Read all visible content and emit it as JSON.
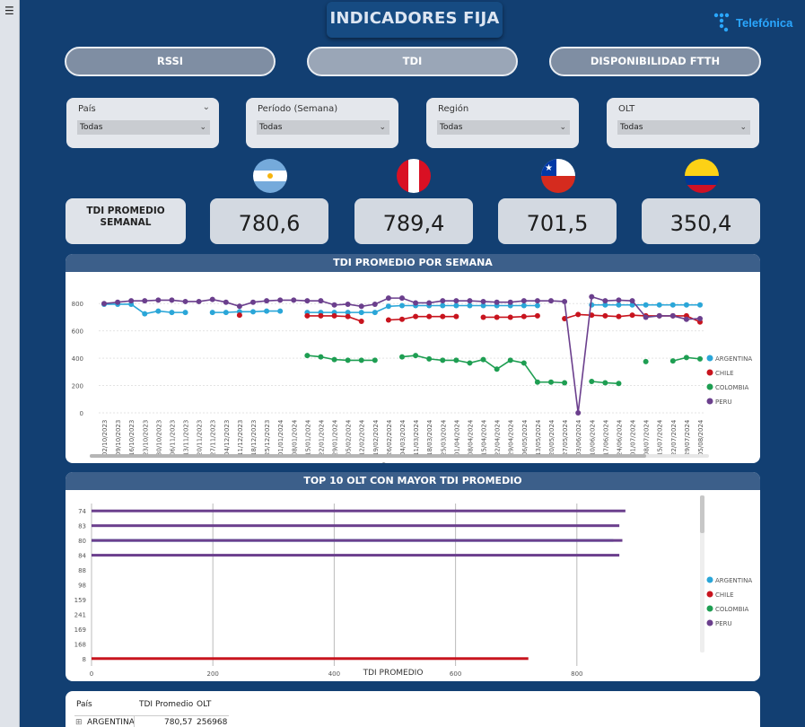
{
  "header": {
    "title": "INDICADORES FIJA",
    "brand": "Telefónica"
  },
  "tabs": [
    {
      "label": "RSSI",
      "active": false
    },
    {
      "label": "TDI",
      "active": true
    },
    {
      "label": "DISPONIBILIDAD FTTH",
      "active": false
    }
  ],
  "filters": [
    {
      "label": "País",
      "value": "Todas"
    },
    {
      "label": "Período (Semana)",
      "value": "Todas"
    },
    {
      "label": "Región",
      "value": "Todas"
    },
    {
      "label": "OLT",
      "value": "Todas"
    }
  ],
  "kpi": {
    "label": "TDI PROMEDIO SEMANAL",
    "values": [
      {
        "country": "Argentina",
        "flag": "argentina-flag-icon",
        "value": "780,6"
      },
      {
        "country": "Peru",
        "flag": "peru-flag-icon",
        "value": "789,4"
      },
      {
        "country": "Chile",
        "flag": "chile-flag-icon",
        "value": "701,5"
      },
      {
        "country": "Colombia",
        "flag": "colombia-flag-icon",
        "value": "350,4"
      }
    ]
  },
  "colors": {
    "ARGENTINA": "#2aa6d8",
    "CHILE": "#c8141e",
    "COLOMBIA": "#1e9e52",
    "PERU": "#6b3f8d"
  },
  "legend": [
    "ARGENTINA",
    "CHILE",
    "COLOMBIA",
    "PERU"
  ],
  "chart_data": [
    {
      "type": "line",
      "title": "TDI PROMEDIO POR SEMANA",
      "xlabel": "Semana",
      "ylabel": "",
      "ylim": [
        0,
        900
      ],
      "yticks": [
        0,
        200,
        400,
        600,
        800
      ],
      "x": [
        "02/10/2023",
        "09/10/2023",
        "16/10/2023",
        "23/10/2023",
        "30/10/2023",
        "06/11/2023",
        "13/11/2023",
        "20/11/2023",
        "27/11/2023",
        "04/12/2023",
        "11/12/2023",
        "18/12/2023",
        "25/12/2023",
        "01/01/2024",
        "08/01/2024",
        "15/01/2024",
        "22/01/2024",
        "29/01/2024",
        "05/02/2024",
        "12/02/2024",
        "19/02/2024",
        "26/02/2024",
        "04/03/2024",
        "11/03/2024",
        "18/03/2024",
        "25/03/2024",
        "01/04/2024",
        "08/04/2024",
        "15/04/2024",
        "22/04/2024",
        "29/04/2024",
        "06/05/2024",
        "13/05/2024",
        "20/05/2024",
        "27/05/2024",
        "03/06/2024",
        "10/06/2024",
        "17/06/2024",
        "24/06/2024",
        "01/07/2024",
        "08/07/2024",
        "15/07/2024",
        "22/07/2024",
        "29/07/2024",
        "05/08/2024"
      ],
      "xticks_shown": [
        "02/10/2023",
        "09/10/2023",
        "16/10/2023",
        "23/10/2023",
        "30/10/2023",
        "06/11/2023",
        "13/11/2023",
        "20/11/2023",
        "27/11/2023",
        "04/12/2023",
        "11/12/2023",
        "18/12/2023",
        "25/12/2023",
        "01/01/2024",
        "08/01/2024",
        "15/01/2024",
        "22/01/2024",
        "29/01/2024",
        "05/02/2024",
        "12/02/2024",
        "19/02/2024",
        "26/02/2024",
        "04/03/2024",
        "11/03/2024",
        "18/03/2024",
        "25/03/2024",
        "01/04/2024",
        "08/04/2024",
        "15/04/2024",
        "22/04/2024",
        "29/04/2024",
        "06/05/2024",
        "13/05/2024",
        "20/05/2024",
        "27/05/2024",
        "03/06/2024",
        "10/06/2024",
        "17/06/2024",
        "24/06/2024",
        "01/07/2024",
        "08/07/2024",
        "15/07/2024",
        "22/07/2024",
        "29/07/2024",
        "05/08/2024"
      ],
      "series": [
        {
          "name": "ARGENTINA",
          "values": [
            795,
            795,
            795,
            725,
            745,
            735,
            735,
            null,
            735,
            735,
            740,
            740,
            745,
            745,
            null,
            735,
            735,
            735,
            735,
            735,
            735,
            780,
            785,
            785,
            785,
            785,
            785,
            785,
            785,
            785,
            785,
            785,
            785,
            null,
            null,
            null,
            790,
            790,
            790,
            790,
            790,
            790,
            790,
            790,
            790
          ]
        },
        {
          "name": "CHILE",
          "values": [
            null,
            null,
            null,
            null,
            null,
            null,
            null,
            null,
            null,
            null,
            715,
            null,
            null,
            null,
            null,
            710,
            710,
            710,
            705,
            670,
            null,
            680,
            685,
            705,
            705,
            705,
            705,
            null,
            700,
            700,
            700,
            705,
            710,
            null,
            690,
            720,
            715,
            710,
            705,
            715,
            710,
            710,
            710,
            710,
            665
          ]
        },
        {
          "name": "COLOMBIA",
          "values": [
            null,
            null,
            null,
            null,
            null,
            null,
            null,
            null,
            null,
            null,
            null,
            null,
            null,
            null,
            null,
            420,
            410,
            390,
            385,
            385,
            385,
            null,
            410,
            420,
            395,
            385,
            385,
            365,
            390,
            320,
            385,
            365,
            225,
            225,
            220,
            null,
            230,
            220,
            215,
            null,
            375,
            null,
            380,
            405,
            395
          ]
        },
        {
          "name": "PERU",
          "values": [
            800,
            810,
            820,
            820,
            825,
            825,
            815,
            815,
            830,
            810,
            780,
            810,
            820,
            825,
            825,
            820,
            820,
            790,
            795,
            780,
            795,
            840,
            840,
            805,
            805,
            820,
            820,
            820,
            815,
            810,
            810,
            820,
            820,
            820,
            815,
            0,
            850,
            820,
            825,
            820,
            700,
            710,
            710,
            685,
            690
          ]
        }
      ]
    },
    {
      "type": "bar",
      "title": "TOP 10 OLT CON MAYOR TDI PROMEDIO",
      "xlabel": "TDI PROMEDIO",
      "ylabel": "",
      "xlim": [
        0,
        1000
      ],
      "xticks": [
        0,
        200,
        400,
        600,
        800
      ],
      "categories": [
        "74",
        "83",
        "80",
        "84",
        "88",
        "98",
        "159",
        "241",
        "169",
        "168",
        "8"
      ],
      "series": [
        {
          "name": "ARGENTINA",
          "values": [
            null,
            null,
            860,
            null,
            null,
            null,
            null,
            null,
            null,
            null,
            null
          ]
        },
        {
          "name": "CHILE",
          "values": [
            null,
            null,
            null,
            null,
            null,
            null,
            null,
            null,
            null,
            null,
            720
          ]
        },
        {
          "name": "COLOMBIA",
          "values": [
            null,
            null,
            null,
            null,
            null,
            null,
            null,
            null,
            null,
            null,
            null
          ]
        },
        {
          "name": "PERU",
          "values": [
            880,
            870,
            875,
            870,
            null,
            null,
            null,
            null,
            null,
            null,
            null
          ]
        }
      ]
    }
  ],
  "table": {
    "headers": [
      "País",
      "TDI Promedio",
      "OLT"
    ],
    "rows": [
      {
        "expand": "⊞",
        "country": "ARGENTINA",
        "tdi": "780,57",
        "olt": "256968"
      }
    ]
  }
}
